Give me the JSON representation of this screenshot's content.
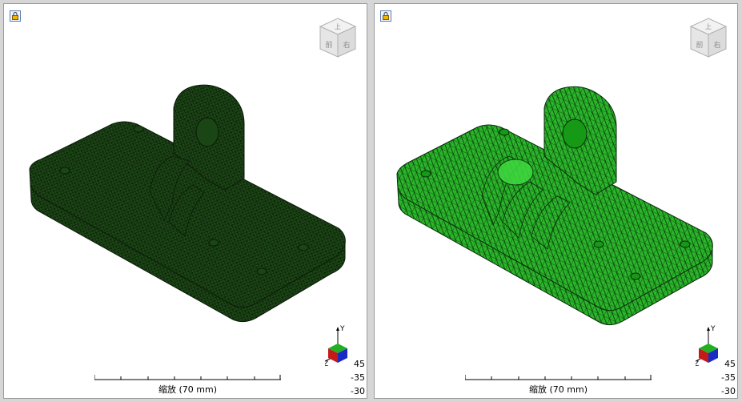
{
  "viewports": [
    {
      "id": "left",
      "scale_label": "缩放 (70 mm)",
      "triad": {
        "y": "Y",
        "z": "Z"
      },
      "rotation": [
        "45",
        "-35",
        "-30"
      ],
      "view_cube": {
        "top": "上",
        "front": "前",
        "right": "右"
      },
      "mesh_color": "#2f7a20"
    },
    {
      "id": "right",
      "scale_label": "缩放 (70 mm)",
      "triad": {
        "y": "Y",
        "z": "Z"
      },
      "rotation": [
        "45",
        "-35",
        "-30"
      ],
      "view_cube": {
        "top": "上",
        "front": "前",
        "right": "右"
      },
      "mesh_color": "#1fbf1f"
    }
  ]
}
